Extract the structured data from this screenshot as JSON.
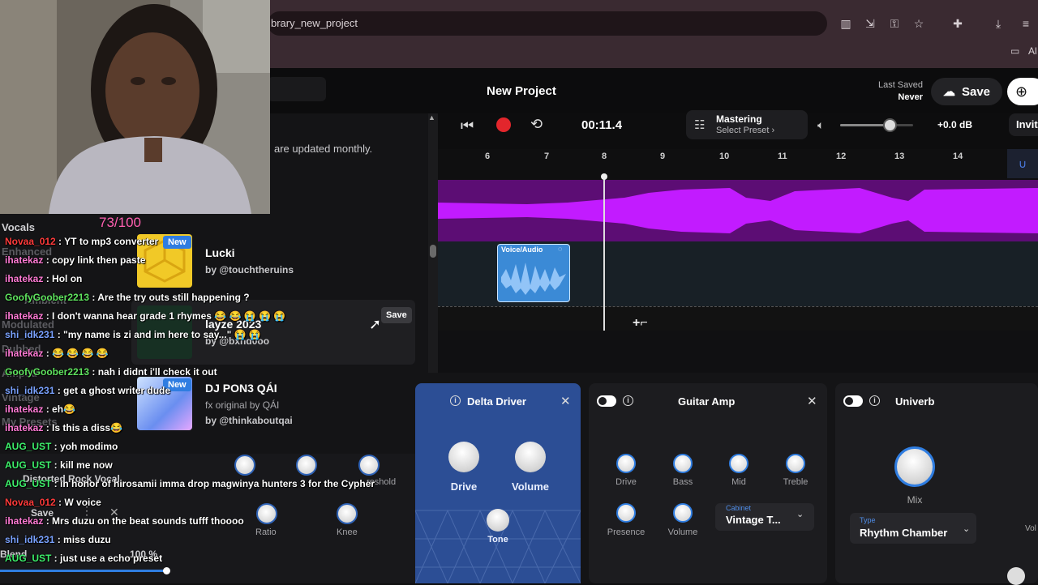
{
  "browser": {
    "url": "brary_new_project",
    "bookmarks_label": "Al"
  },
  "app": {
    "project_title": "New Project",
    "last_saved_label": "Last Saved",
    "last_saved_value": "Never",
    "save_label": "Save",
    "invite_label": "Invit"
  },
  "transport": {
    "time": "00:11.4",
    "mastering_title": "Mastering",
    "mastering_preset": "Select Preset ›",
    "volume_db": "+0.0 dB",
    "volume_level": 0.68
  },
  "timeline": {
    "ticks": [
      "6",
      "7",
      "8",
      "9",
      "10",
      "11",
      "12",
      "13",
      "14"
    ],
    "clip_label": "Voice/Audio"
  },
  "library": {
    "note": "are updated monthly.",
    "hover_save": "Save",
    "new_badge": "New",
    "items": [
      {
        "title": "Lucki",
        "subtitle": "",
        "by": "by @touchtheruins"
      },
      {
        "title": "layze 2023",
        "subtitle": "",
        "by": "by @bxnd0oo"
      },
      {
        "title": "DJ PON3 QÁI",
        "subtitle": "fx original by QÁI",
        "by": "by @thinkaboutqai"
      }
    ]
  },
  "left_panel": {
    "ghost_labels": [
      "Vocals",
      "Enhanced",
      "Ambient",
      "Modulated",
      "Dubbed",
      "Amped",
      "Vintage",
      "My Presets"
    ],
    "preset_name": "Distorted Rock Vocal",
    "save_label": "Save",
    "threshold_label": "reshold",
    "ratio_label": "Ratio",
    "knee_label": "Knee",
    "blend_label": "Blend",
    "blend_value": "100 %"
  },
  "chat": {
    "donation": "73/100",
    "messages": [
      {
        "user": "Novaa_012",
        "color": "#ff3b3b",
        "text": "YT to mp3 converter"
      },
      {
        "user": "ihatekaz",
        "color": "#ff7bd5",
        "text": "copy link then paste"
      },
      {
        "user": "ihatekaz",
        "color": "#ff7bd5",
        "text": "Hol on"
      },
      {
        "user": "GoofyGoober2213",
        "color": "#5fe35f",
        "text": "Are the try outs still happening ?"
      },
      {
        "user": "ihatekaz",
        "color": "#ff7bd5",
        "text": "I don't wanna hear grade 1 rhymes 😂 😂 😭 😭 😭"
      },
      {
        "user": "shi_idk231",
        "color": "#7aa2ff",
        "text": "\"my name is zi and im here to say...\" 😭 😭"
      },
      {
        "user": "ihatekaz",
        "color": "#ff7bd5",
        "text": "😂 😂 😂 😂"
      },
      {
        "user": "GoofyGoober2213",
        "color": "#5fe35f",
        "text": "nah i didnt i'll check it out"
      },
      {
        "user": "shi_idk231",
        "color": "#7aa2ff",
        "text": "get a ghost writer dude"
      },
      {
        "user": "ihatekaz",
        "color": "#ff7bd5",
        "text": "eh😂"
      },
      {
        "user": "ihatekaz",
        "color": "#ff7bd5",
        "text": "Is this a diss😂"
      },
      {
        "user": "AUG_UST",
        "color": "#3df06b",
        "text": "yoh modimo"
      },
      {
        "user": "AUG_UST",
        "color": "#3df06b",
        "text": "kill me now"
      },
      {
        "user": "AUG_UST",
        "color": "#3df06b",
        "text": "in honor of hirosamii imma drop magwinya hunters 3 for the Cypher"
      },
      {
        "user": "Novaa_012",
        "color": "#ff3b3b",
        "text": "W voice"
      },
      {
        "user": "ihatekaz",
        "color": "#ff7bd5",
        "text": "Mrs duzu on the beat sounds tufff thoooo"
      },
      {
        "user": "shi_idk231",
        "color": "#7aa2ff",
        "text": "miss duzu"
      },
      {
        "user": "AUG_UST",
        "color": "#3df06b",
        "text": "just use a echo preset"
      }
    ]
  },
  "effects": {
    "delta": {
      "title": "Delta Driver",
      "drive": "Drive",
      "volume": "Volume",
      "tone": "Tone"
    },
    "guitar": {
      "title": "Guitar Amp",
      "drive": "Drive",
      "bass": "Bass",
      "mid": "Mid",
      "treble": "Treble",
      "presence": "Presence",
      "volume": "Volume",
      "cabinet_label": "Cabinet",
      "cabinet_value": "Vintage T..."
    },
    "univerb": {
      "title": "Univerb",
      "mix": "Mix",
      "type_label": "Type",
      "type_value": "Rhythm Chamber",
      "vol_short": "Vol"
    }
  },
  "colors": {
    "accent_blue": "#2f7de1",
    "track_purple": "#5c0d74",
    "waveform_purple": "#c21bff",
    "clip_blue": "#3b8ad6",
    "record_red": "#e3262c"
  }
}
